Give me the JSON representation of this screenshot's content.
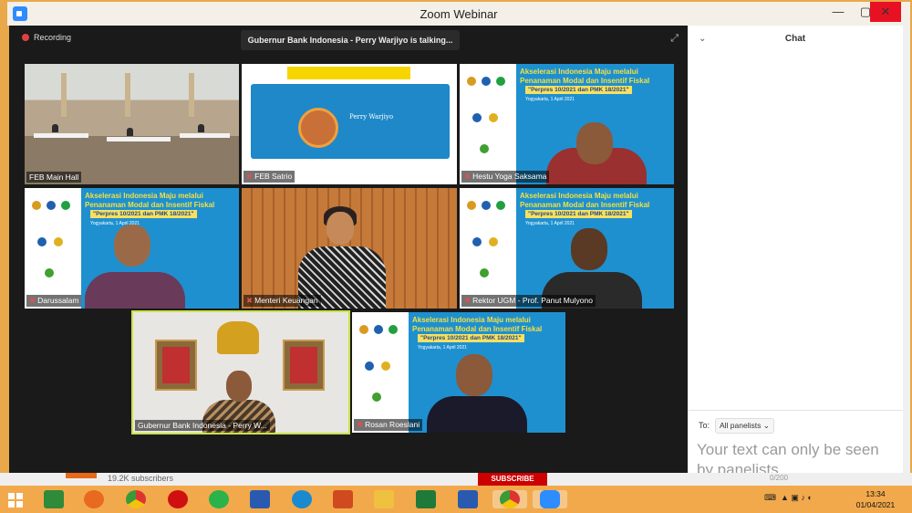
{
  "window": {
    "title": "Zoom Webinar",
    "min": "—",
    "max": "▢",
    "close": "✕"
  },
  "recording": {
    "label": "Recording"
  },
  "speaking": {
    "text": "Gubernur Bank Indonesia - Perry Warjiyo is talking..."
  },
  "participants": [
    {
      "name": "FEB Main Hall",
      "muted": false
    },
    {
      "name": "FEB Satrio",
      "muted": true
    },
    {
      "name": "Hestu Yoga Saksama",
      "muted": true
    },
    {
      "name": "Darussalam",
      "muted": true
    },
    {
      "name": "Menteri Keuangan",
      "muted": true
    },
    {
      "name": "Rektor UGM - Prof. Panut Mulyono",
      "muted": true
    },
    {
      "name": "Gubernur Bank Indonesia - Perry W...",
      "muted": false
    },
    {
      "name": "Rosan Roeslani",
      "muted": true
    }
  ],
  "banner": {
    "title": "Akselerasi Indonesia Maju melalui Penanaman Modal dan Insentif Fiskal",
    "subtitle": "\"Perpres 10/2021 dan PMK 18/2021\"",
    "place_date": "Yogyakarta, 1 April 2021"
  },
  "satrio_slide": {
    "signature": "Perry Warjiyo"
  },
  "chat": {
    "title": "Chat",
    "to_label": "To:",
    "recipient": "All panelists ⌄",
    "input_text": "Your text can only be seen by panelists"
  },
  "background": {
    "subscribers": "19.2K subscribers",
    "subscribe": "SUBSCRIBE",
    "counter": "0/200"
  },
  "taskbar": {
    "apps": [
      "powerpoint-alt-icon",
      "firefox-icon",
      "chrome-icon",
      "opera-icon",
      "whatsapp-icon",
      "visio-icon",
      "edge-icon",
      "powerpoint-icon",
      "file-explorer-icon",
      "excel-icon",
      "word-icon",
      "chrome-active-icon",
      "zoom-icon"
    ],
    "time": "13:34",
    "date": "01/04/2021"
  },
  "colors": {
    "accent": "#2d8cff",
    "active_speaker": "#c8e34a",
    "close": "#e81123"
  }
}
